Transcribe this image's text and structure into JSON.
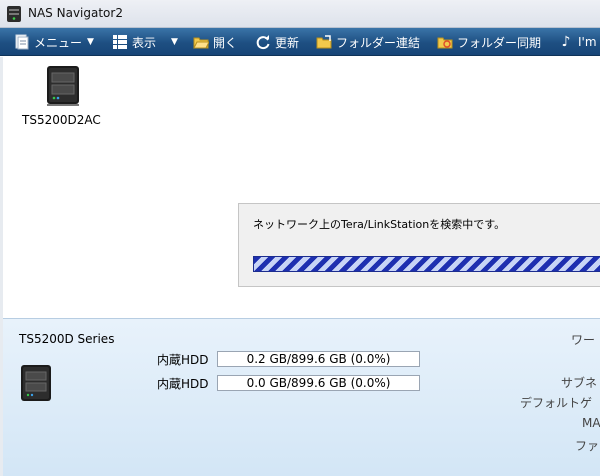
{
  "window": {
    "title": "NAS Navigator2"
  },
  "toolbar": {
    "items": [
      {
        "label": "メニュー",
        "icon": "menu-doc-icon",
        "dropdown": true
      },
      {
        "label": "表示",
        "icon": "view-grid-icon",
        "dropdown": true
      },
      {
        "label": "開く",
        "icon": "folder-open-icon"
      },
      {
        "label": "更新",
        "icon": "refresh-icon"
      },
      {
        "label": "フォルダー連結",
        "icon": "folder-link-icon"
      },
      {
        "label": "フォルダー同期",
        "icon": "folder-sync-icon"
      },
      {
        "label": "I'm",
        "icon": "music-note-icon"
      }
    ]
  },
  "devices": [
    {
      "name": "TS5200D2AC",
      "icon": "nas-device-icon"
    }
  ],
  "search_dialog": {
    "message": "ネットワーク上のTera/LinkStationを検索中です。"
  },
  "detail": {
    "series": "TS5200D Series",
    "hdd": [
      {
        "label": "内蔵HDD",
        "value": "0.2 GB/899.6 GB (0.0%)"
      },
      {
        "label": "内蔵HDD",
        "value": "0.0 GB/899.6 GB (0.0%)"
      }
    ],
    "right_labels": [
      "ワー",
      "サブネ",
      "デフォルトゲ",
      "MA",
      "ファ"
    ]
  },
  "colors": {
    "toolbar": "#1e4f82",
    "progress": "#1e2fb0",
    "detail_bg": "#dcebf8"
  }
}
